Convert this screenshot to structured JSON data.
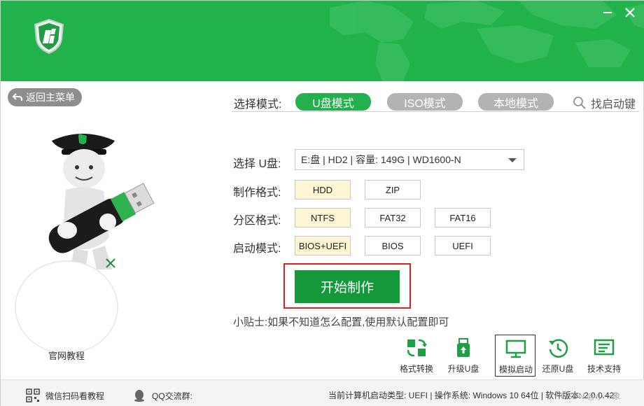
{
  "window": {
    "minimize_icon": "minimize-icon",
    "close_icon": "close-icon",
    "brand_color": "#21b24b"
  },
  "left": {
    "back_label": "返回主菜单",
    "bubble_label": "官网教程"
  },
  "modes": {
    "label": "选择模式:",
    "items": [
      "U盘模式",
      "ISO模式",
      "本地模式"
    ],
    "selected": "U盘模式",
    "find_boot": "找启动键"
  },
  "form": {
    "usb_label": "选择 U盘:",
    "usb_value": "E:盘  |  HD2  |  容量: 149G  |  WD1600-N",
    "format_label": "制作格式:",
    "format_options": [
      "HDD",
      "ZIP"
    ],
    "format_selected": "HDD",
    "partition_label": "分区格式:",
    "partition_options": [
      "NTFS",
      "FAT32",
      "FAT16"
    ],
    "partition_selected": "NTFS",
    "boot_label": "启动模式:",
    "boot_options": [
      "BIOS+UEFI",
      "BIOS",
      "UEFI"
    ],
    "boot_selected": "BIOS+UEFI"
  },
  "start_button": "开始制作",
  "tip": "小贴士:如果不知道怎么配置,使用默认配置即可",
  "tools": [
    {
      "label": "格式转换",
      "icon": "convert-icon"
    },
    {
      "label": "升级U盘",
      "icon": "usb-upgrade-icon"
    },
    {
      "label": "模拟启动",
      "icon": "monitor-icon"
    },
    {
      "label": "还原U盘",
      "icon": "restore-icon"
    },
    {
      "label": "技术支持",
      "icon": "support-icon"
    }
  ],
  "footer": {
    "wechat": "微信扫码看教程",
    "qq": "QQ交流群:",
    "status": "当前计算机启动类型:  UEFI  |  操作系统:  Windows 10 64位  |  软件版本:  2.0.0.42",
    "watermark": "CSDN @小一象"
  }
}
